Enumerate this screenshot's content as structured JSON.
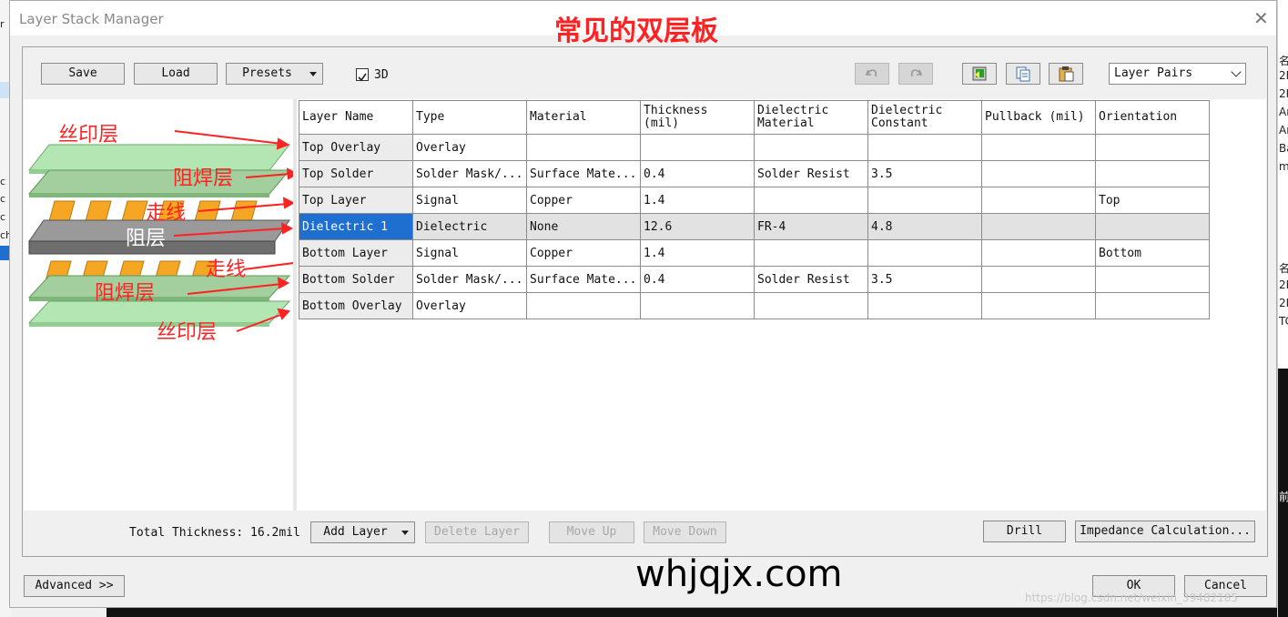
{
  "background": {
    "left_fragments": [
      "r",
      "c",
      "c",
      "c",
      "ch"
    ],
    "right_fragments": [
      "名",
      "2M",
      "2M",
      "Ar",
      "Ar",
      "Ba",
      "m",
      "名",
      "2M",
      "2M",
      "TC",
      "前"
    ]
  },
  "dialog": {
    "title": "Layer Stack Manager",
    "close_glyph": "✕"
  },
  "watermarks": {
    "title": "常见的双层板",
    "site": "whjqjx.com",
    "csdn": "https://blog.csdn.net/weixin_39482185"
  },
  "toolbar": {
    "save": "Save",
    "load": "Load",
    "presets": "Presets",
    "show3d_label": "3D",
    "show3d_checked": true,
    "view_select": "Layer Pairs"
  },
  "diagram": {
    "labels": {
      "top_overlay": "丝印层",
      "top_solder": "阻焊层",
      "top_traces": "走线",
      "dielectric": "阻层",
      "bottom_traces": "走线",
      "bottom_solder": "阻焊层",
      "bottom_overlay": "丝印层"
    },
    "colors": {
      "overlay": "#b4e6b4",
      "solder": "#a3cf9e",
      "copper": "#f5a623",
      "dielectric": "#7a7a7a",
      "annotation": "#ff2222"
    }
  },
  "table": {
    "headers": [
      [
        "Layer Name"
      ],
      [
        "Type"
      ],
      [
        "Material"
      ],
      [
        "Thickness",
        "(mil)"
      ],
      [
        "Dielectric",
        "Material"
      ],
      [
        "Dielectric",
        "Constant"
      ],
      [
        "Pullback (mil)"
      ],
      [
        "Orientation"
      ]
    ],
    "rows": [
      [
        "Top Overlay",
        "Overlay",
        "",
        "",
        "",
        "",
        "",
        ""
      ],
      [
        "Top Solder",
        "Solder Mask/...",
        "Surface Mate...",
        "0.4",
        "Solder Resist",
        "3.5",
        "",
        ""
      ],
      [
        "Top Layer",
        "Signal",
        "Copper",
        "1.4",
        "",
        "",
        "",
        "Top"
      ],
      [
        "Dielectric 1",
        "Dielectric",
        "None",
        "12.6",
        "FR-4",
        "4.8",
        "",
        ""
      ],
      [
        "Bottom Layer",
        "Signal",
        "Copper",
        "1.4",
        "",
        "",
        "",
        "Bottom"
      ],
      [
        "Bottom Solder",
        "Solder Mask/...",
        "Surface Mate...",
        "0.4",
        "Solder Resist",
        "3.5",
        "",
        ""
      ],
      [
        "Bottom Overlay",
        "Overlay",
        "",
        "",
        "",
        "",
        "",
        ""
      ]
    ],
    "selected_row": 3
  },
  "bottombar": {
    "total_thickness": "Total Thickness: 16.2mil",
    "add_layer": "Add Layer",
    "delete_layer": "Delete Layer",
    "move_up": "Move Up",
    "move_down": "Move Down",
    "drill": "Drill",
    "impedance": "Impedance Calculation..."
  },
  "footer": {
    "advanced": "Advanced >>",
    "ok": "OK",
    "cancel": "Cancel"
  }
}
